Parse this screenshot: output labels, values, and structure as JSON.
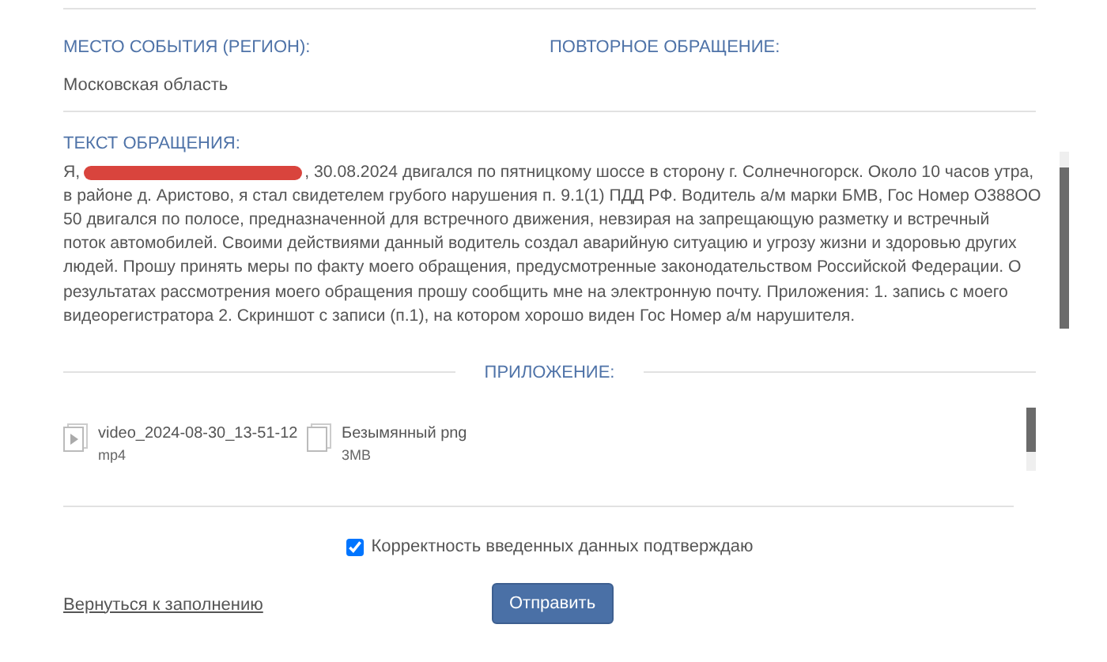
{
  "fields": [
    {
      "label": "МЕСТО СОБЫТИЯ (РЕГИОН):",
      "value": "Московская область"
    },
    {
      "label": "ПОВТОРНОЕ ОБРАЩЕНИЕ:"
    }
  ],
  "message": {
    "label": "ТЕКСТ ОБРАЩЕНИЯ:",
    "text_start": "Я,",
    "redacted": true,
    "text": ", 30.08.2024 двигался по пятницкому шоссе в сторону г. Солнечногорск. Около 10 часов утра,",
    "lines": [
      "в районе д. Аристово, я стал свидетелем грубого нарушения п. 9.1(1) ПДД РФ. Водитель а/м марки БМВ, Гос Номер О388ОО",
      "50 двигался по полосе, предназначенной для встречного движения, невзирая на запрещающую разметку и встречный",
      "поток автомобилей. Своими действиями данный водитель создал аварийную ситуацию и угрозу жизни и здоровью других",
      "людей. Прошу принять меры по факту моего обращения, предусмотренные законодательством Российской Федерации. О",
      "результатах рассмотрения моего обращения прошу сообщить мне на электронную почту. Приложения: 1. запись с моего",
      "видеорегистратора 2. Скриншот с записи (п.1), на котором хорошо виден Гос Номер а/м нарушителя."
    ]
  },
  "attachments": {
    "label": "ПРИЛОЖЕНИЕ:",
    "files": [
      {
        "kind": "video",
        "name": "video_2024-08-30_13-51-12",
        "detail": "mp4"
      },
      {
        "kind": "image",
        "name": "Безымянный png",
        "detail": "3MB"
      }
    ]
  },
  "confirm": {
    "label": "Корректность введенных данных подтверждаю",
    "checked": true
  },
  "back_link": "Вернуться к заполнению",
  "submit": "Отправить"
}
